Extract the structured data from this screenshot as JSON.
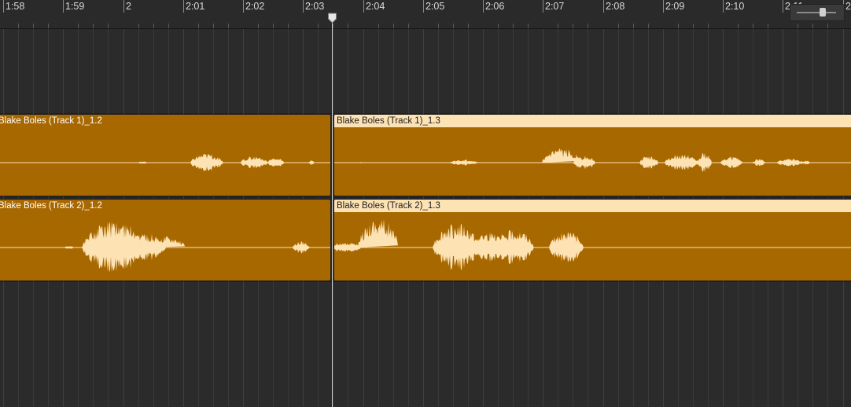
{
  "ruler": {
    "labels": [
      "1:58",
      "1:59",
      "2",
      "2:01",
      "2:02",
      "2:03",
      "2:04",
      "2:05",
      "2:06",
      "2:07",
      "2:08",
      "2:09",
      "2:10",
      "2:11",
      "2"
    ]
  },
  "zoom": {
    "level": 0.65
  },
  "colors": {
    "region": "#a86800",
    "region_selected_header": "#fde2b4",
    "waveform": "#fde2b4",
    "background": "#2b2b2b"
  },
  "regions": [
    {
      "id": "r1",
      "label": "Blake Boles (Track 1)_1.2",
      "selected": false
    },
    {
      "id": "r2",
      "label": "Blake Boles (Track 1)_1.3",
      "selected": true
    },
    {
      "id": "r3",
      "label": "Blake Boles (Track 2)_1.2",
      "selected": false
    },
    {
      "id": "r4",
      "label": "Blake Boles (Track 2)_1.3",
      "selected": true
    }
  ],
  "playhead": {
    "time": "2:03.3"
  },
  "icons": {
    "playhead": "playhead-marker-icon",
    "zoom": "zoom-slider"
  }
}
